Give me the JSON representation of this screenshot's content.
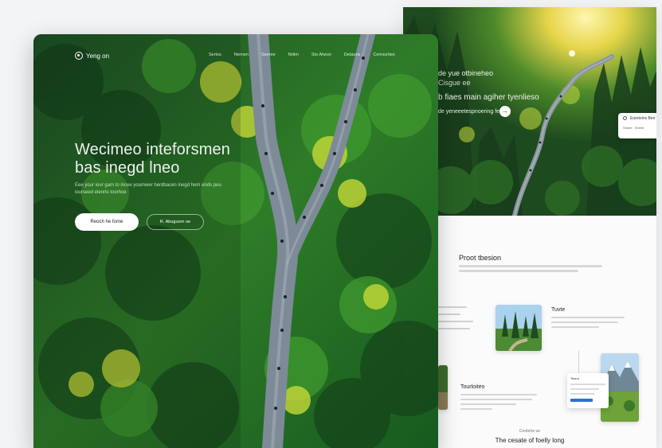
{
  "front": {
    "brand": "Yeng on",
    "nav": [
      "Sertos",
      "Nernen",
      "Seeree",
      "Nrtim",
      "Sto Ahesn",
      "Detauns",
      "Cerrourties"
    ],
    "hero_title": "Wecimeo inteforsmen bas inegd lneo",
    "hero_sub": "Eee your iour gam to incee youmwer herdbacen inegd hem ends peu iourseed elenrlo toorhoe",
    "cta_primary": "Reoch he forne",
    "cta_secondary": "R. Abuguorn oe"
  },
  "back": {
    "hero_line1": "de yue otbineheo",
    "hero_line2": "Cisgue ee",
    "hero_line3": "b fiaes main agiher tyenlieso",
    "hero_cta": "de yeneeetespnoering feeng",
    "search_label": "Eoerteins Ben",
    "search_opt1": "Seane",
    "search_opt2": "Eeeter",
    "section_title": "Proot tbesion",
    "trail_title": "Tuvte",
    "tour_title": "Tourloiteo",
    "mini_card_title": "Tesrut",
    "contact_eyebrow": "Conterte ue",
    "contact_title": "The cesate of foelly long"
  },
  "colors": {
    "forest_dark": "#1b4a22",
    "forest_mid": "#2f7a2a",
    "sunlit": "#c9d93a",
    "road": "#7d8a97",
    "accent_blue": "#2f6fd6"
  }
}
